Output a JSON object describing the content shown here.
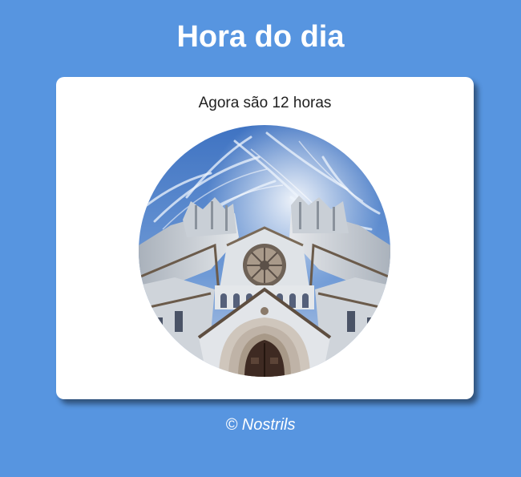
{
  "header": {
    "title": "Hora do dia"
  },
  "card": {
    "message": "Agora são 12 horas"
  },
  "footer": {
    "text": "© Nostrils"
  },
  "colors": {
    "background": "#5795e0",
    "card": "#ffffff",
    "sky": "#4c7fc8",
    "facade": "#d9dde2"
  }
}
